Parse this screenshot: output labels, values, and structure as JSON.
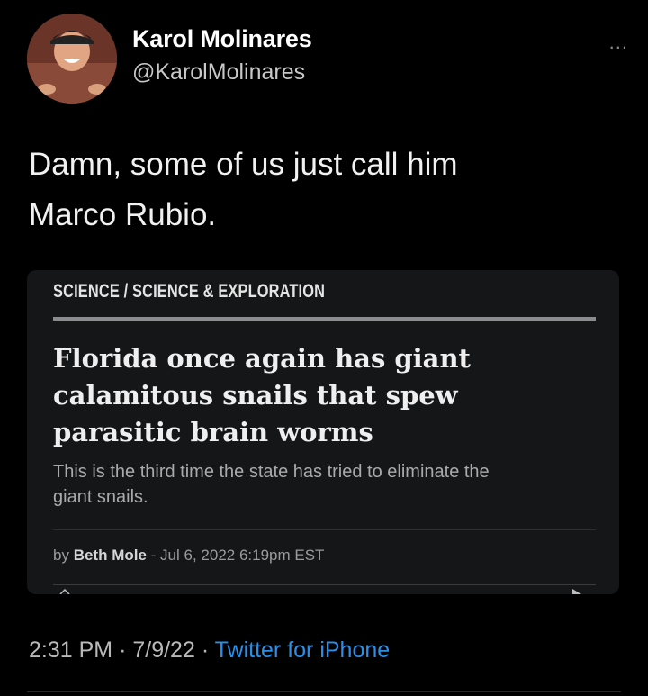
{
  "user": {
    "display_name": "Karol Molinares",
    "handle": "@KarolMolinares"
  },
  "more_label": "...",
  "tweet": {
    "text_line1": "Damn, some of us just call him",
    "text_line2": "Marco Rubio."
  },
  "card": {
    "category": "SCIENCE / SCIENCE & EXPLORATION",
    "headline_line1": "Florida once again has giant",
    "headline_line2": "calamitous snails that spew",
    "headline_line3": "parasitic brain worms",
    "subhead_line1": "This is the third time the state has tried to eliminate the",
    "subhead_line2": "giant snails.",
    "byline_prefix": "by",
    "author": "Beth Mole",
    "byline_date": "- Jul 6, 2022 6:19pm EST"
  },
  "meta": {
    "time": "2:31 PM",
    "separator": "·",
    "date": "7/9/22",
    "source": "Twitter for iPhone"
  },
  "colors": {
    "background": "#000000",
    "card_background": "#151618",
    "link_blue": "#2b8fe8"
  }
}
